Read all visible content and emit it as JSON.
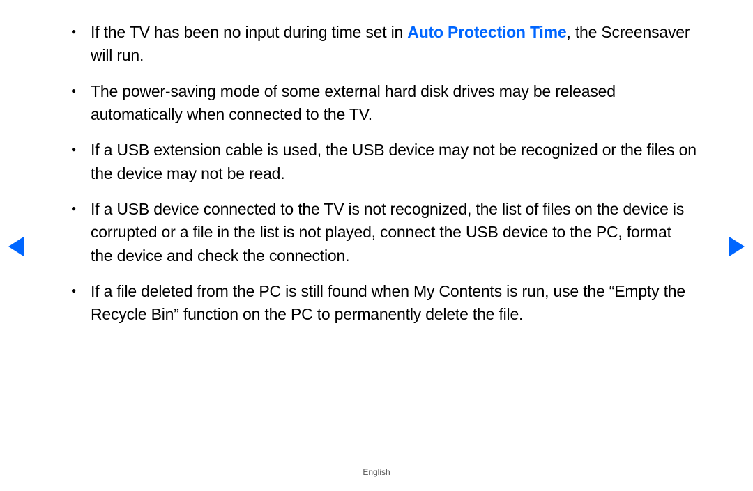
{
  "bullets": [
    {
      "prefix": "If the TV has been no input during time set in ",
      "highlight": "Auto Protection Time",
      "suffix": ", the Screensaver will run."
    },
    {
      "text": "The power-saving mode of some external hard disk drives may be released automatically when connected to the TV."
    },
    {
      "text": "If a USB extension cable is used, the USB device may not be recognized or the files on the device may not be read."
    },
    {
      "text": "If a USB device connected to the TV is not recognized, the list of files on the device is corrupted or a file in the list is not played, connect the USB device to the PC, format the device and check the connection."
    },
    {
      "text": "If a file deleted from the PC is still found when My Contents is run, use the “Empty the Recycle Bin” function on the PC to permanently delete the file."
    }
  ],
  "footer": "English"
}
